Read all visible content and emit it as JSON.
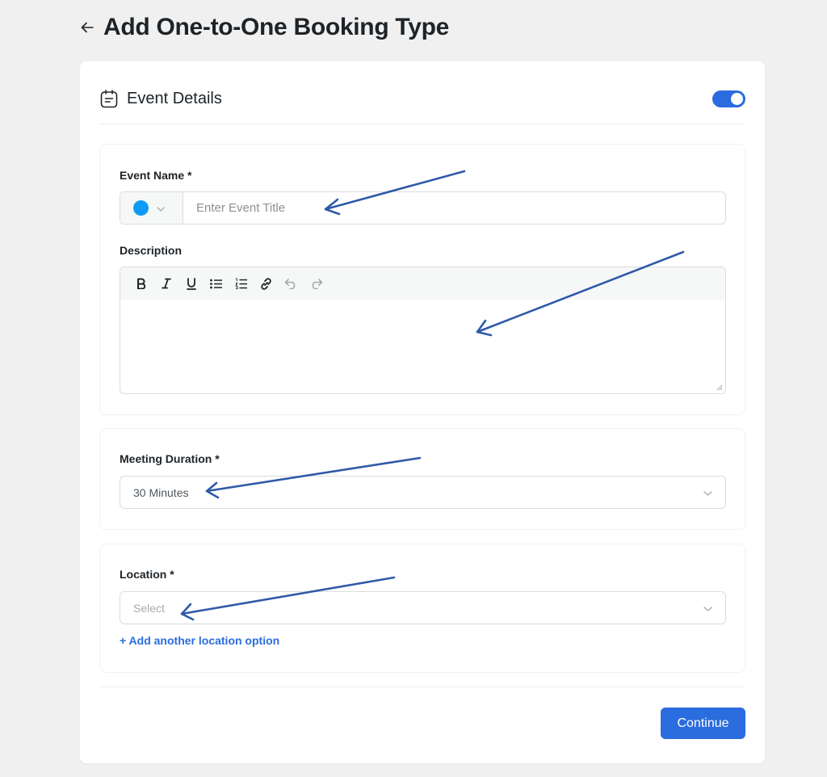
{
  "page": {
    "title": "Add One-to-One Booking Type"
  },
  "section": {
    "title": "Event Details",
    "toggle_on": true
  },
  "event_name": {
    "label": "Event Name *",
    "placeholder": "Enter Event Title",
    "value": "",
    "color": "#0f9bf5"
  },
  "description": {
    "label": "Description",
    "toolbar": [
      "bold-icon",
      "italic-icon",
      "underline-icon",
      "bullet-list-icon",
      "numbered-list-icon",
      "link-icon",
      "undo-icon",
      "redo-icon"
    ],
    "value": ""
  },
  "duration": {
    "label": "Meeting Duration *",
    "value": "30 Minutes"
  },
  "location": {
    "label": "Location *",
    "placeholder": "Select",
    "add_link": "+ Add another location option"
  },
  "actions": {
    "continue": "Continue"
  },
  "colors": {
    "accent": "#2b6cde",
    "annotation_arrow": "#2f5aa8"
  }
}
